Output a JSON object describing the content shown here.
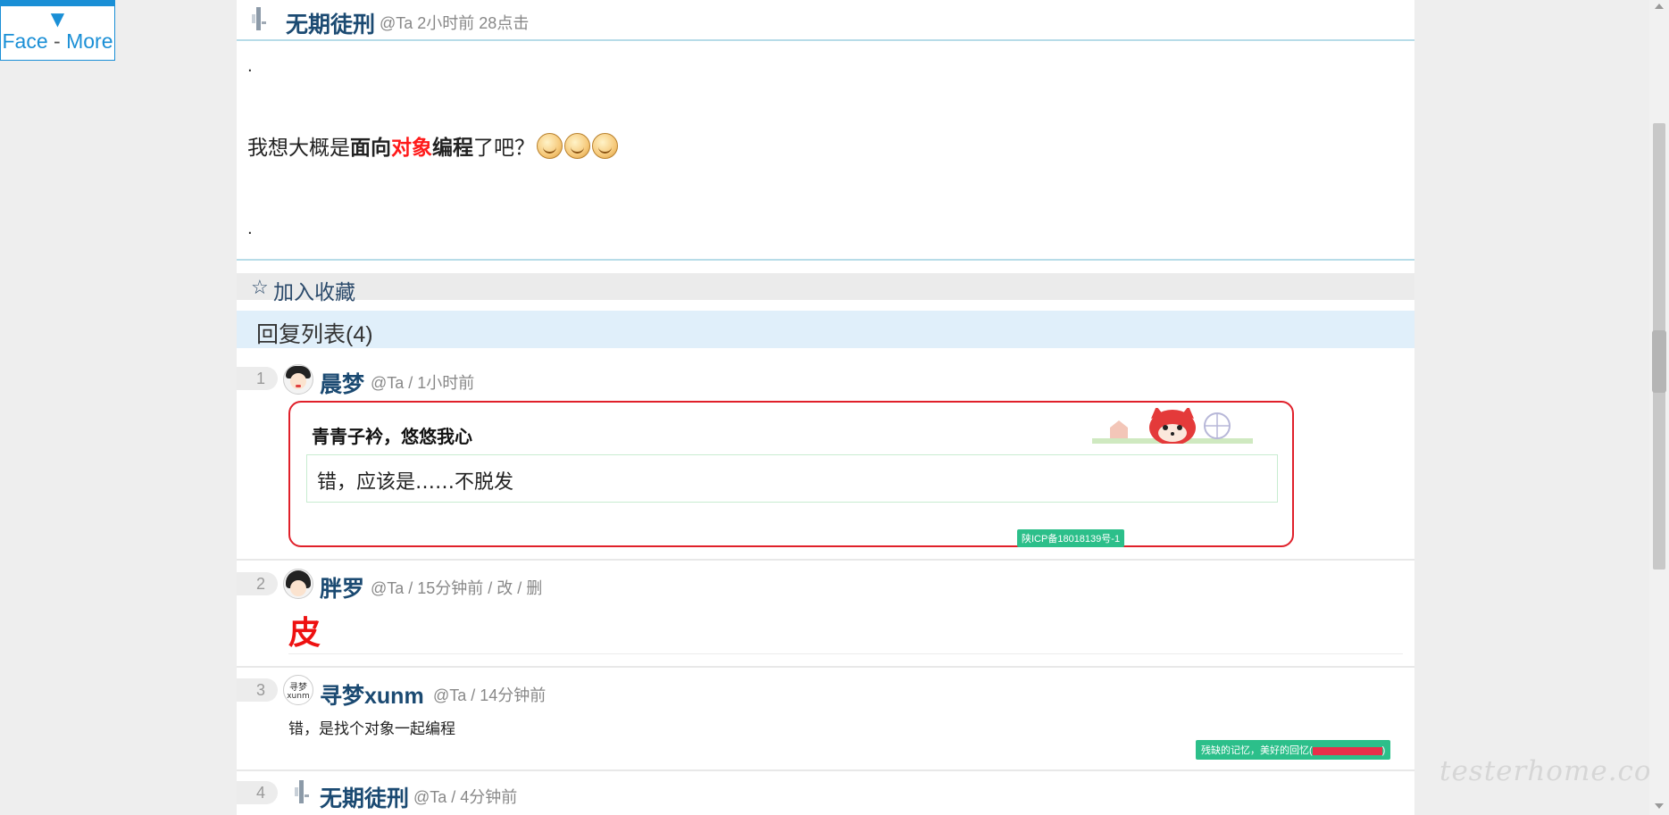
{
  "face_widget": {
    "arrow": "▼",
    "face": "Face",
    "sep": "-",
    "more": "More"
  },
  "topic": {
    "author": "无期徒刑",
    "meta": "@Ta 2小时前 28点击",
    "dot1": ".",
    "content_pre": "我想大概是",
    "content_b1": "面向",
    "content_red": "对象",
    "content_b2": "编程",
    "content_post": "了吧？",
    "dot2": "."
  },
  "favorite": {
    "star": "☆",
    "label": "加入收藏"
  },
  "reply_header": "回复列表(4)",
  "replies": [
    {
      "floor": "1",
      "name": "晨梦",
      "meta": "@Ta / 1小时前",
      "card_title": "青青子衿，悠悠我心",
      "card_body": "错，应该是……不脱发",
      "tag": "陕ICP备18018139号-1"
    },
    {
      "floor": "2",
      "name": "胖罗",
      "meta": "@Ta / 15分钟前 / 改 / 删",
      "content": "皮"
    },
    {
      "floor": "3",
      "name": "寻梦xunm",
      "avatar_top": "寻梦",
      "avatar_bottom": "xunm",
      "meta": "@Ta / 14分钟前",
      "content": "错，是找个对象一起编程",
      "tag": "残缺的记忆，美好的回忆("
    },
    {
      "floor": "4",
      "name": "无期徒刑",
      "meta": "@Ta / 4分钟前"
    }
  ],
  "watermark": "testerhome.com",
  "colors": {
    "accent": "#1a8fd6",
    "name": "#1b4a72",
    "red": "#ee1111",
    "tag": "#2cbf8a"
  }
}
